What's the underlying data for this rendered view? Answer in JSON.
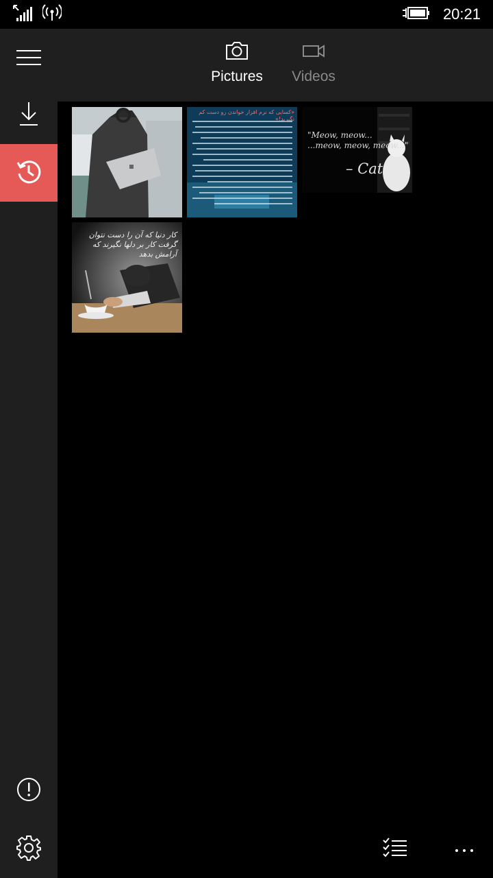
{
  "status_bar": {
    "time": "20:21",
    "icons": [
      "signal-icon",
      "wifi-icon",
      "battery-charging-icon"
    ]
  },
  "sidebar": {
    "items": [
      {
        "icon": "hamburger-icon"
      },
      {
        "icon": "download-icon"
      },
      {
        "icon": "history-icon",
        "active": true
      },
      {
        "icon": "info-icon"
      },
      {
        "icon": "gear-icon"
      }
    ],
    "accent": "#e55a56"
  },
  "pivot": {
    "tabs": [
      {
        "label": "Pictures",
        "icon": "camera-icon",
        "selected": true
      },
      {
        "label": "Videos",
        "icon": "video-camera-icon",
        "selected": false
      }
    ]
  },
  "gallery": {
    "thumbnails": [
      {
        "name": "man-with-laptop-photo"
      },
      {
        "name": "persian-text-poster",
        "text": "«کسایی که نرم افزار خواندن رو دست کم نگیرید!»"
      },
      {
        "name": "cat-quote-image",
        "quote": "\"Meow, meow...\n...meow, meow, meow...\"",
        "attribution": "– Cat"
      },
      {
        "name": "man-sleeping-desk-photo",
        "text": "کار دنیا که آن را دست نتوان گرفت کار بر دلها نگیرند که آرامش بدهد"
      }
    ]
  },
  "appbar": {
    "items": [
      {
        "icon": "select-list-icon"
      },
      {
        "icon": "more-icon"
      }
    ]
  }
}
